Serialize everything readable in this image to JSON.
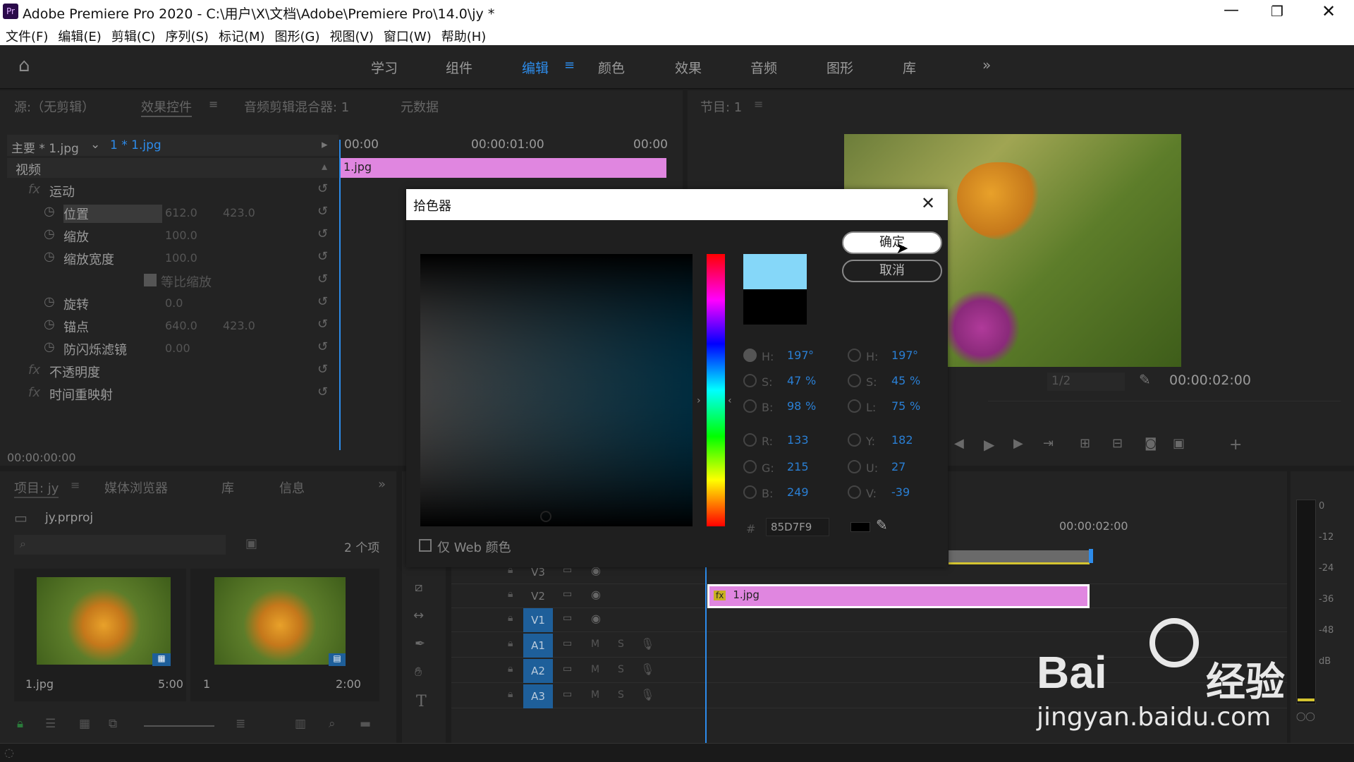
{
  "window": {
    "title": "Adobe Premiere Pro 2020 - C:\\用户\\X\\文档\\Adobe\\Premiere Pro\\14.0\\jy *",
    "app_icon": "Pr"
  },
  "menu": [
    "文件(F)",
    "编辑(E)",
    "剪辑(C)",
    "序列(S)",
    "标记(M)",
    "图形(G)",
    "视图(V)",
    "窗口(W)",
    "帮助(H)"
  ],
  "workspaces": [
    "学习",
    "组件",
    "编辑",
    "颜色",
    "效果",
    "音频",
    "图形",
    "库"
  ],
  "source_panel": {
    "tabs": [
      "源:（无剪辑）",
      "效果控件",
      "音频剪辑混合器: 1",
      "元数据"
    ],
    "master": "主要 * 1.jpg",
    "clip": "1 * 1.jpg",
    "ruler": [
      "00:00",
      "00:00:01:00",
      "00:00"
    ],
    "clip_bar": "1.jpg",
    "section": "视频",
    "effects": [
      {
        "name": "运动"
      },
      {
        "name": "位置",
        "v1": "612.0",
        "v2": "423.0"
      },
      {
        "name": "缩放",
        "v1": "100.0"
      },
      {
        "name": "缩放宽度",
        "v1": "100.0"
      },
      {
        "name": "等比缩放"
      },
      {
        "name": "旋转",
        "v1": "0.0"
      },
      {
        "name": "锚点",
        "v1": "640.0",
        "v2": "423.0"
      },
      {
        "name": "防闪烁滤镜",
        "v1": "0.00"
      },
      {
        "name": "不透明度"
      },
      {
        "name": "时间重映射"
      }
    ],
    "timecode": "00:00:00:00"
  },
  "program": {
    "tab": "节目: 1",
    "scale": "1/2",
    "timecode": "00:00:02:00"
  },
  "project": {
    "tabs": [
      "项目: jy",
      "媒体浏览器",
      "库",
      "信息"
    ],
    "file": "jy.prproj",
    "count": "2 个项",
    "items": [
      {
        "name": "1.jpg",
        "dur": "5:00"
      },
      {
        "name": "1",
        "dur": "2:00"
      }
    ]
  },
  "timeline": {
    "time_label": "00:00:02:00",
    "tracks": [
      "V3",
      "V2",
      "V1",
      "A1",
      "A2",
      "A3"
    ],
    "clip": "1.jpg",
    "m": "M",
    "s": "S"
  },
  "meter": {
    "labels": [
      "0",
      "-12",
      "-24",
      "-36",
      "-48",
      "dB"
    ]
  },
  "picker": {
    "title": "拾色器",
    "ok": "确定",
    "cancel": "取消",
    "web_only": "仅 Web 颜色",
    "new_color": "#85D7F9",
    "old_color": "#000000",
    "hsb": {
      "h": "197",
      "s": "47",
      "b": "98"
    },
    "hsl": {
      "h": "197",
      "s": "45",
      "l": "75"
    },
    "rgb": {
      "r": "133",
      "g": "215",
      "b": "249"
    },
    "yuv": {
      "y": "182",
      "u": "27",
      "v": "-39"
    },
    "hex": "85D7F9",
    "labels": {
      "h": "H:",
      "s": "S:",
      "b": "B:",
      "l": "L:",
      "r": "R:",
      "g": "G:",
      "y": "Y:",
      "u": "U:",
      "v": "V:",
      "hash": "#",
      "deg": "°",
      "pct": "%"
    }
  },
  "watermark": {
    "brand": "Bai",
    "sub": "经验",
    "url": "jingyan.baidu.com"
  }
}
